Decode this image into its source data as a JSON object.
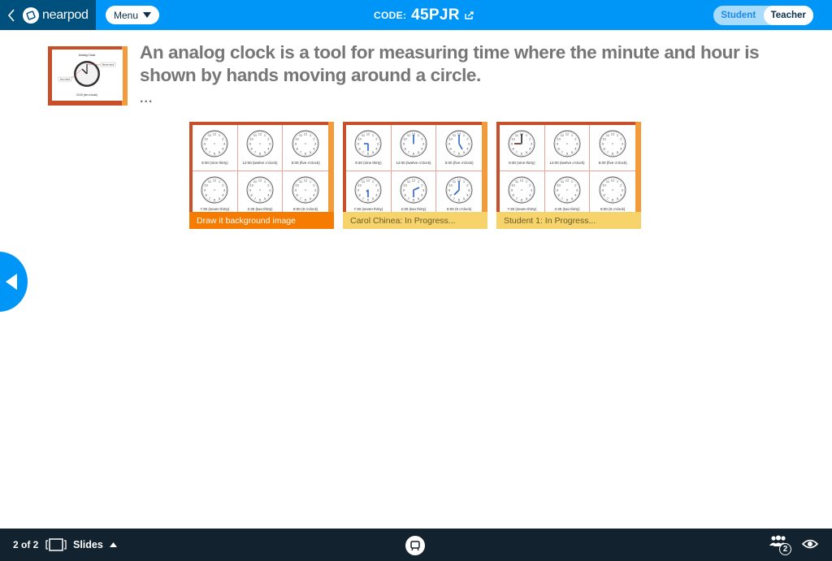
{
  "topbar": {
    "app_name": "nearpod",
    "menu_label": "Menu",
    "code_label": "CODE:",
    "code_value": "45PJR",
    "roles": {
      "student": "Student",
      "teacher": "Teacher",
      "active": "Teacher"
    },
    "colors": {
      "bar": "#0096f8",
      "brand": "#00507e"
    }
  },
  "slide": {
    "thumbnail": {
      "title": "Analog Clock",
      "minute_label": "Minute hand",
      "hour_label": "Hour hand",
      "caption": "10:00 (ten o'clock)"
    },
    "question": "An analog clock is a tool for measuring time where the minute and hour is shown by hands moving around a circle.",
    "more": "..."
  },
  "clock_labels": [
    "9:30 (nine thirty)",
    "12:00 (twelve o'clock)",
    "5:00 (five o'clock)",
    "7:30 (seven thirty)",
    "2:30 (two thirty)",
    "8:00 (8 o'clock)"
  ],
  "cards": [
    {
      "caption": "Draw it background image",
      "style": "orange",
      "hands": "none"
    },
    {
      "caption": "Carol Chinea: In Progress...",
      "style": "yellow",
      "hands": "blue"
    },
    {
      "caption": "Student 1: In Progress...",
      "style": "yellow",
      "hands": "first"
    }
  ],
  "bottombar": {
    "page_count": "2 of 2",
    "slides_label": "Slides",
    "students_count": "2"
  }
}
